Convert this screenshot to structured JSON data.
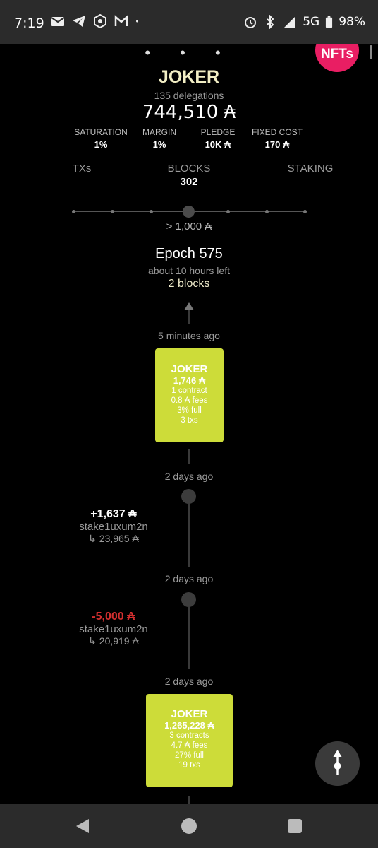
{
  "status_bar": {
    "time": "7:19",
    "left_icons": [
      "mail-icon",
      "telegram-icon",
      "crypto-app-icon",
      "gmail-icon",
      "dot-icon"
    ],
    "network": "5G",
    "battery": "98%",
    "right_icons": [
      "alarm-icon",
      "bluetooth-icon",
      "signal-icon",
      "battery-icon"
    ]
  },
  "header": {
    "more_dots": "• • •",
    "nfts_label": "NFTs"
  },
  "pool": {
    "name": "JOKER",
    "delegations": "135 delegations",
    "total_stake": "744,510 ₳",
    "stats": [
      {
        "label": "SATURATION",
        "value": "1%"
      },
      {
        "label": "MARGIN",
        "value": "1%"
      },
      {
        "label": "PLEDGE",
        "value": "10K ₳"
      },
      {
        "label": "FIXED COST",
        "value": "170 ₳"
      }
    ]
  },
  "tabs": [
    {
      "label": "TXs",
      "sub": ""
    },
    {
      "label": "BLOCKS",
      "sub": "302"
    },
    {
      "label": "STAKING",
      "sub": ""
    }
  ],
  "filter": {
    "value_label": "> 1,000 ₳",
    "steps": 7,
    "selected_index": 3
  },
  "epoch": {
    "title": "Epoch 575",
    "time_left": "about 10 hours left",
    "blocks": "2 blocks"
  },
  "timeline": {
    "block1": {
      "time": "5 minutes ago",
      "pool": "JOKER",
      "amount": "1,746 ₳",
      "contracts": "1 contract",
      "fees": "0.8 ₳ fees",
      "full": "3% full",
      "txs": "3 txs"
    },
    "tx1": {
      "time": "2 days ago",
      "amount": "+1,637 ₳",
      "address": "stake1uxum2n",
      "balance": "↳ 23,965 ₳",
      "color": "#ffffff"
    },
    "tx2": {
      "time": "2 days ago",
      "amount": "-5,000 ₳",
      "address": "stake1uxum2n",
      "balance": "↳ 20,919 ₳",
      "color": "#d32f2f"
    },
    "block2": {
      "time": "2 days ago",
      "pool": "JOKER",
      "amount": "1,265,228 ₳",
      "contracts": "3 contracts",
      "fees": "4.7 ₳ fees",
      "full": "27% full",
      "txs": "19 txs"
    }
  },
  "fab": {
    "icon": "scroll-direction-icon"
  },
  "nav_bar": {
    "icons": [
      "back-icon",
      "home-icon",
      "recents-icon"
    ]
  },
  "colors": {
    "accent_green": "#cddc39",
    "nfts_pink": "#e91e63",
    "pool_name": "#f2eec4",
    "negative": "#d32f2f"
  }
}
